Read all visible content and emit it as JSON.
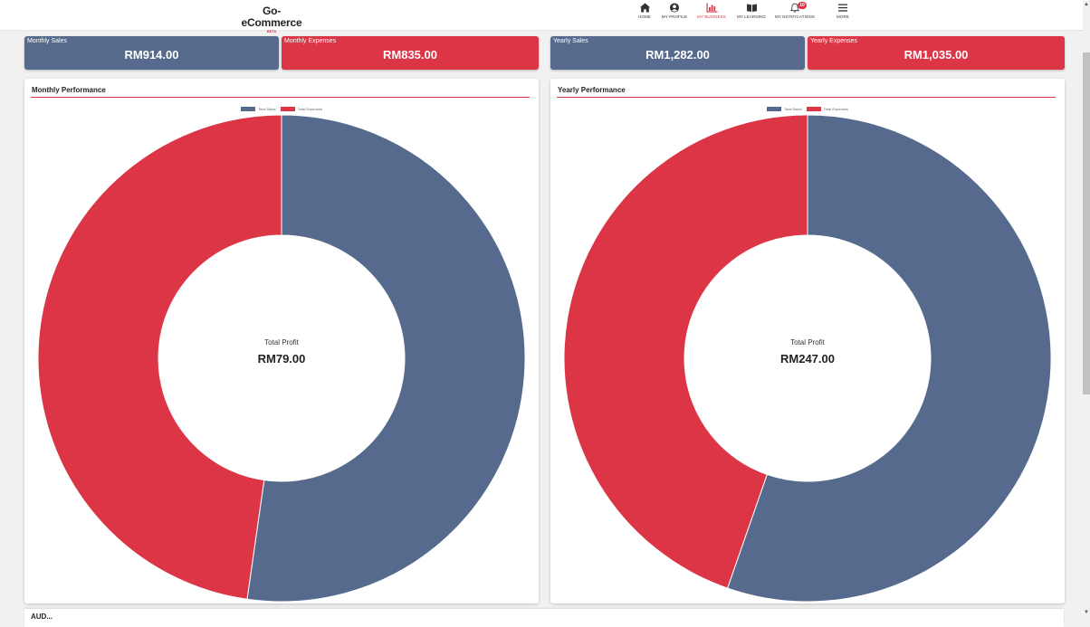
{
  "brand": {
    "name": "Go-eCommerce",
    "tag": "BETA"
  },
  "nav": [
    {
      "label": "HOME",
      "icon": "home-icon"
    },
    {
      "label": "MY PROFILE",
      "icon": "user-circle-icon"
    },
    {
      "label": "MY BUSINESS",
      "icon": "bar-chart-icon",
      "active": true
    },
    {
      "label": "MY LEARNING",
      "icon": "book-icon"
    },
    {
      "label": "MY NOTIFICATIONS",
      "icon": "bell-icon",
      "badge": "10"
    },
    {
      "label": "MORE",
      "icon": "menu-icon"
    }
  ],
  "stats": {
    "monthly_sales": {
      "label": "Monthly Sales",
      "value": "RM914.00"
    },
    "monthly_expenses": {
      "label": "Monthly Expenses",
      "value": "RM835.00"
    },
    "yearly_sales": {
      "label": "Yearly Sales",
      "value": "RM1,282.00"
    },
    "yearly_expenses": {
      "label": "Yearly Expenses",
      "value": "RM1,035.00"
    }
  },
  "legend": {
    "sales": "Total Sales",
    "expenses": "Total Expenses"
  },
  "colors": {
    "sales": "#556a8c",
    "expenses": "#dc3545",
    "accent": "#dc3545"
  },
  "panels": {
    "monthly": {
      "title": "Monthly Performance",
      "center_label": "Total Profit",
      "center_value": "RM79.00"
    },
    "yearly": {
      "title": "Yearly Performance",
      "center_label": "Total Profit",
      "center_value": "RM247.00"
    }
  },
  "bottom": {
    "title": "AUD..."
  },
  "chart_data": [
    {
      "type": "pie",
      "title": "Monthly Performance",
      "categories": [
        "Total Sales",
        "Total Expenses"
      ],
      "values": [
        914,
        835
      ]
    },
    {
      "type": "pie",
      "title": "Yearly Performance",
      "categories": [
        "Total Sales",
        "Total Expenses"
      ],
      "values": [
        1282,
        1035
      ]
    }
  ]
}
